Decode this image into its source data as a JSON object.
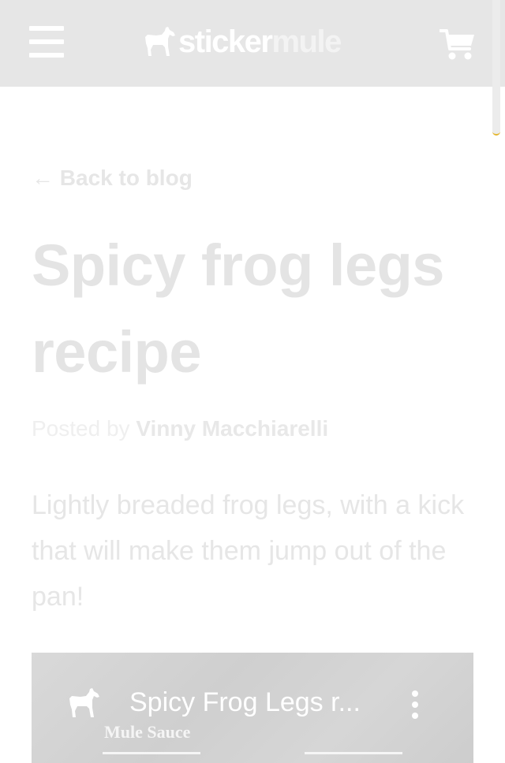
{
  "header": {
    "brand_part1": "sticker",
    "brand_part2": "mule",
    "menu_icon": "hamburger-menu-icon",
    "cart_icon": "shopping-cart-icon",
    "logo_icon": "mule-logo-icon"
  },
  "article": {
    "back_link": "← Back to blog",
    "title": "Spicy frog legs recipe",
    "byline_prefix": "Posted by",
    "author": "Vinny Macchiarelli",
    "intro": "Lightly breaded frog legs, with a kick that will make them jump out of the pan!"
  },
  "video": {
    "title": "Spicy Frog Legs r...",
    "brand_overlay": "Mule Sauce",
    "menu_icon": "more-vertical-icon"
  },
  "colors": {
    "header_bg": "#e6e6e6",
    "scrollbar_accent": "#e4b52c"
  }
}
